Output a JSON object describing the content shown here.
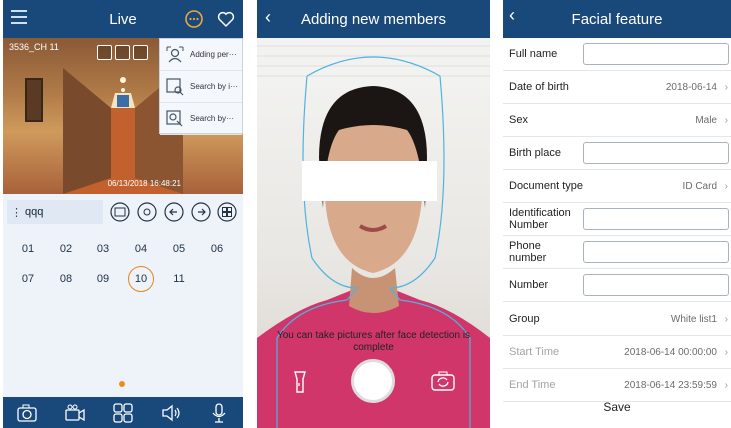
{
  "live": {
    "title": "Live",
    "camera_label": "3536_CH 11",
    "timestamp": "06/13/2018 16:48:21",
    "menu": [
      "Adding per···",
      "Search by i···",
      "Search by···"
    ],
    "search_value": "qqq",
    "channels": [
      "01",
      "02",
      "03",
      "04",
      "05",
      "06",
      "07",
      "08",
      "09",
      "10",
      "11"
    ],
    "selected_channel": "10",
    "page_dot_color": "#f08a1c"
  },
  "capture": {
    "title": "Adding new members",
    "hint": "You can take pictures after face detection is complete"
  },
  "facial": {
    "title": "Facial feature",
    "fields": [
      {
        "label": "Full name",
        "type": "input",
        "value": ""
      },
      {
        "label": "Date of birth",
        "type": "select",
        "value": "2018-06-14"
      },
      {
        "label": "Sex",
        "type": "select",
        "value": "Male"
      },
      {
        "label": "Birth place",
        "type": "input",
        "value": ""
      },
      {
        "label": "Document type",
        "type": "select",
        "value": "ID Card"
      },
      {
        "label": "Identification Number",
        "type": "input",
        "value": ""
      },
      {
        "label": "Phone number",
        "type": "input",
        "value": ""
      },
      {
        "label": "Number",
        "type": "input",
        "value": ""
      },
      {
        "label": "Group",
        "type": "select",
        "value": "White list1"
      },
      {
        "label": "Start Time",
        "type": "select-dim",
        "value": "2018-06-14 00:00:00"
      },
      {
        "label": "End Time",
        "type": "select-dim",
        "value": "2018-06-14 23:59:59"
      }
    ],
    "save_label": "Save"
  },
  "colors": {
    "header": "#18497a",
    "accent": "#f08a1c"
  }
}
